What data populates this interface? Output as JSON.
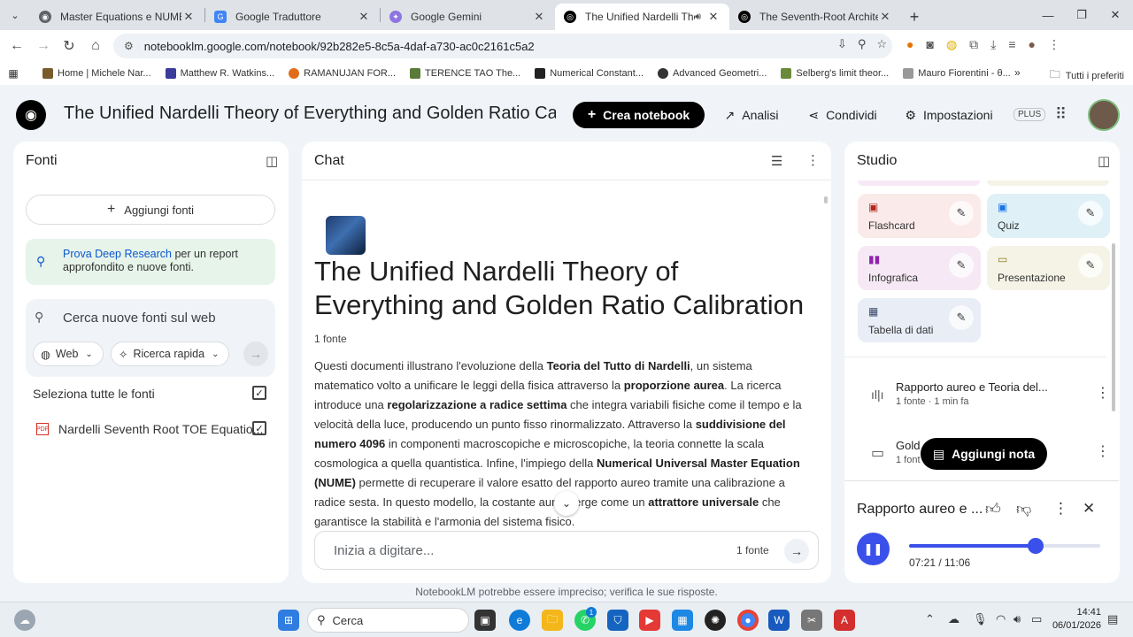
{
  "browser": {
    "tabs": [
      {
        "title": "Master Equations e NUME",
        "color": "#5f6368",
        "active": false
      },
      {
        "title": "Google Traduttore",
        "color": "#4285f4",
        "active": false
      },
      {
        "title": "Google Gemini",
        "color": "#8e75e0",
        "active": false
      },
      {
        "title": "The Unified Nardelli Theory",
        "color": "#000000",
        "active": true
      },
      {
        "title": "The Seventh-Root Architecture",
        "color": "#000000",
        "active": false
      }
    ],
    "address": {
      "url": "notebooklm.google.com/notebook/92b282e5-8c5a-4daf-a730-ac0c2161c5a2"
    },
    "bookmarks": [
      {
        "label": "Home | Michele Nar...",
        "color": "#7a5a2a"
      },
      {
        "label": "Matthew R. Watkins...",
        "color": "#3b3b9a"
      },
      {
        "label": "RAMANUJAN FOR...",
        "color": "#e06c1a"
      },
      {
        "label": "TERENCE TAO  The...",
        "color": "#5a7a3a"
      },
      {
        "label": "Numerical Constant...",
        "color": "#222222"
      },
      {
        "label": "Advanced Geometri...",
        "color": "#333333"
      },
      {
        "label": "Selberg's limit theor...",
        "color": "#6a8a3a"
      },
      {
        "label": "Mauro Fiorentini - θ...",
        "color": "#999999"
      }
    ],
    "bookmarks_all": "Tutti i preferiti"
  },
  "app": {
    "title": "The Unified Nardelli Theory of Everything and Golden Ratio Calibration",
    "create_label": "Crea notebook",
    "analytics_label": "Analisi",
    "share_label": "Condividi",
    "settings_label": "Impostazioni",
    "plan_badge": "PLUS"
  },
  "sources": {
    "title": "Fonti",
    "add_label": "Aggiungi fonti",
    "deep_research_link": "Prova Deep Research",
    "deep_research_text": " per un report approfondito e nuove fonti.",
    "search_placeholder": "Cerca nuove fonti sul web",
    "web_pill": "Web",
    "fast_pill": "Ricerca rapida",
    "select_all": "Seleziona tutte le fonti",
    "items": [
      {
        "name": "Nardelli Seventh Root TOE Equatio..."
      }
    ]
  },
  "chat": {
    "title": "Chat",
    "heading": "The Unified Nardelli Theory of Everything and Golden Ratio Calibration",
    "source_count": "1 fonte",
    "summary": [
      {
        "t": "Questi documenti illustrano l'evoluzione della ",
        "b": false
      },
      {
        "t": "Teoria del Tutto di Nardelli",
        "b": true
      },
      {
        "t": ", un sistema matematico volto a unificare le leggi della fisica attraverso la ",
        "b": false
      },
      {
        "t": "proporzione aurea",
        "b": true
      },
      {
        "t": ". La ricerca introduce una ",
        "b": false
      },
      {
        "t": "regolarizzazione a radice settima",
        "b": true
      },
      {
        "t": " che integra variabili fisiche come il tempo e la velocità della luce, producendo un punto fisso rinormalizzato. Attraverso la ",
        "b": false
      },
      {
        "t": "suddivisione del numero 4096",
        "b": true
      },
      {
        "t": " in componenti macroscopiche e microscopiche, la teoria connette la scala cosmologica a quella quantistica. Infine, l'impiego della ",
        "b": false
      },
      {
        "t": "Numerical Universal Master Equation (NUME)",
        "b": true
      },
      {
        "t": " permette di recuperare il valore esatto del rapporto aureo tramite una calibrazione a radice sesta. In questo modello, la costante aur",
        "b": false
      },
      {
        "t": "   emerge come un ",
        "b": false
      },
      {
        "t": "attrattore universale",
        "b": true
      },
      {
        "t": " che garantisce la stabilità e l'armonia del sistema fisico.",
        "b": false
      }
    ],
    "input_placeholder": "Inizia a digitare...",
    "input_source_count": "1 fonte"
  },
  "studio": {
    "title": "Studio",
    "tiles": [
      {
        "label": "Flashcard",
        "bg": "#fbeaea",
        "icon_color": "#b3261e"
      },
      {
        "label": "Quiz",
        "bg": "#dff1f7",
        "icon_color": "#1a73e8"
      },
      {
        "label": "Infografica",
        "bg": "#f6e9f5",
        "icon_color": "#8e24aa"
      },
      {
        "label": "Presentazione",
        "bg": "#f4f3e6",
        "icon_color": "#8a7a1a"
      },
      {
        "label": "Tabella di dati",
        "bg": "#e8edf6",
        "icon_color": "#3c4a6b"
      }
    ],
    "artifacts": [
      {
        "title": "Rapporto aureo e Teoria del...",
        "sub": "1 fonte · 1 min fa"
      },
      {
        "title": "Gold",
        "sub": "1 font"
      }
    ],
    "add_note": "Aggiungi nota",
    "player": {
      "title": "Rapporto aureo e ...",
      "time": "07:21 / 11:06",
      "progress": 0.663
    }
  },
  "footer": {
    "disclaimer": "NotebookLM potrebbe essere impreciso; verifica le sue risposte."
  },
  "taskbar": {
    "search": "Cerca",
    "time": "14:41",
    "date": "06/01/2026",
    "whatsapp_badge": "1"
  }
}
